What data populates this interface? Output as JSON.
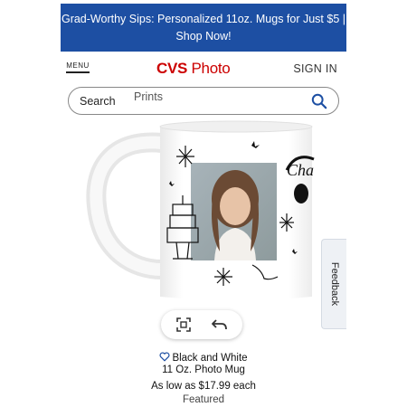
{
  "promo": {
    "line1": "Grad-Worthy Sips: Personalized 11oz. Mugs for Just $5 |",
    "line2": "Shop Now!"
  },
  "header": {
    "menu_label": "MENU",
    "logo_brand": "CVS",
    "logo_product": "Photo",
    "signin_label": "SIGN IN"
  },
  "search": {
    "label": "Search",
    "placeholder": "Prints",
    "icon": "search-icon"
  },
  "mug_art": {
    "text": "Cha"
  },
  "toolbar": {
    "items": [
      "expand-icon",
      "undo-icon"
    ]
  },
  "product": {
    "name_line1": "Black and White",
    "name_line2": "11 Oz. Photo Mug",
    "price": "As low as $17.99 each",
    "badge": "Featured"
  },
  "feedback": {
    "label": "Feedback"
  },
  "colors": {
    "promo_bg": "#1d4fa3",
    "brand_red": "#cc0000",
    "link_blue": "#1d4fa3"
  }
}
